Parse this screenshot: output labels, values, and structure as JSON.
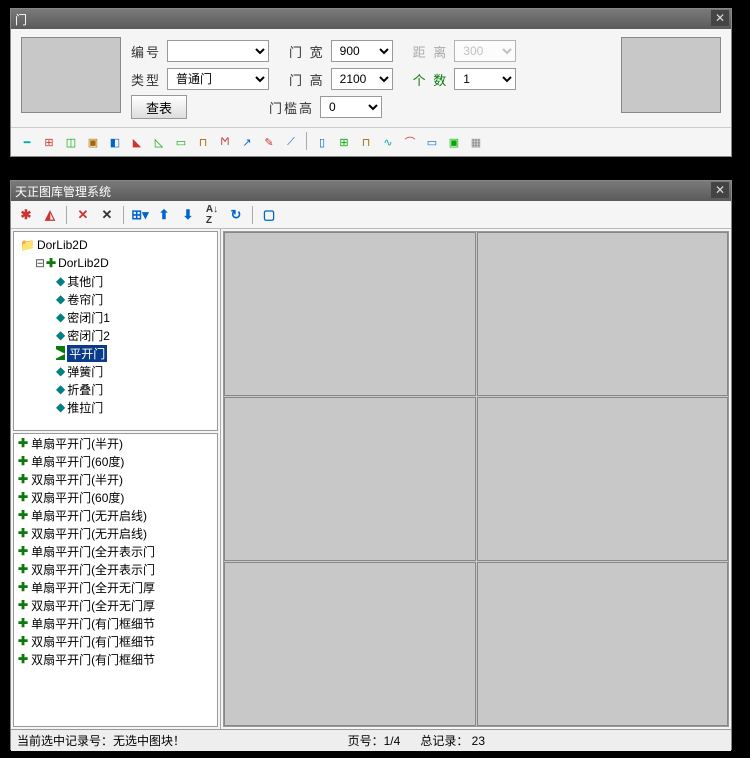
{
  "panel1": {
    "title": "门",
    "labels": {
      "id": "编号",
      "type": "类型",
      "width": "门 宽",
      "height": "门 高",
      "threshold": "门槛高",
      "distance": "距 离",
      "count": "个 数",
      "lookup": "查表"
    },
    "values": {
      "id": "",
      "type": "普通门",
      "width": "900",
      "height": "2100",
      "threshold": "0",
      "distance": "300",
      "count": "1"
    }
  },
  "panel2": {
    "title": "天正图库管理系统",
    "tree": {
      "root": "DorLib2D",
      "sub": "DorLib2D",
      "items": [
        "其他门",
        "卷帘门",
        "密闭门1",
        "密闭门2",
        "平开门",
        "弹簧门",
        "折叠门",
        "推拉门"
      ],
      "selected": "平开门"
    },
    "list": [
      "单扇平开门(半开)",
      "单扇平开门(60度)",
      "双扇平开门(半开)",
      "双扇平开门(60度)",
      "单扇平开门(无开启线)",
      "双扇平开门(无开启线)",
      "单扇平开门(全开表示门",
      "双扇平开门(全开表示门",
      "单扇平开门(全开无门厚",
      "双扇平开门(全开无门厚",
      "单扇平开门(有门框细节",
      "双扇平开门(有门框细节",
      "双扇平开门(有门框细节"
    ],
    "status": {
      "selection": "当前选中记录号：无选中图块！",
      "page": "页号：1/4",
      "total": "总记录：  23"
    }
  }
}
